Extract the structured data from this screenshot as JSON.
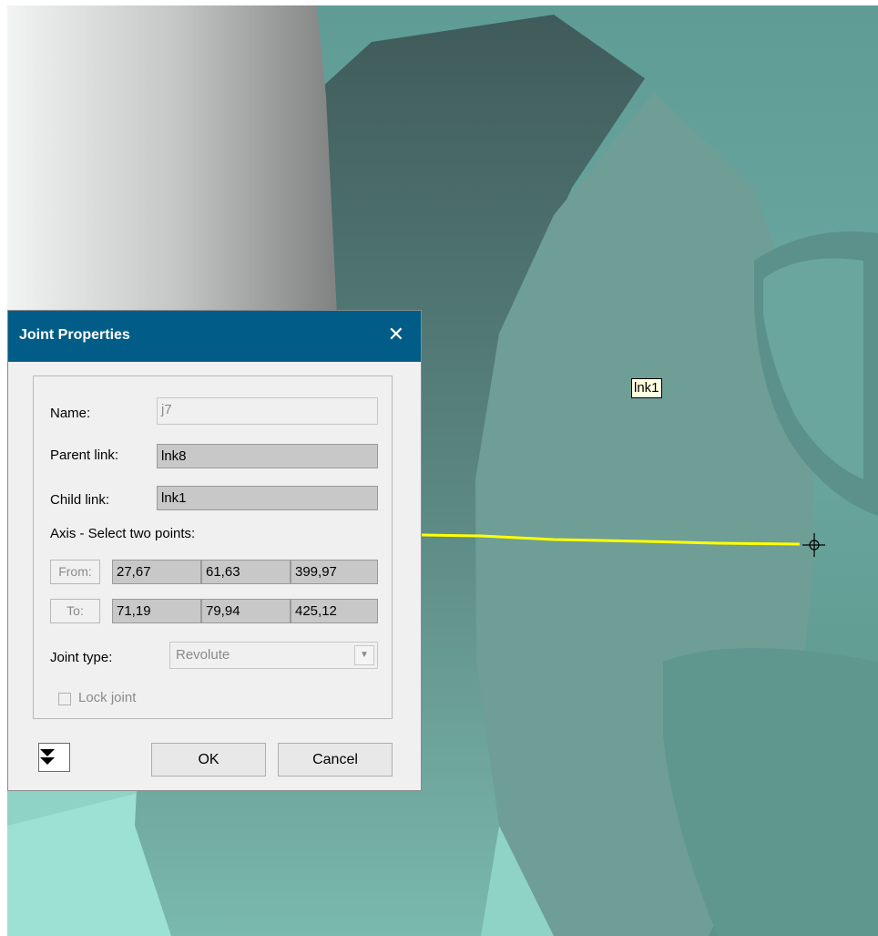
{
  "viewport": {
    "tooltip": "lnk1",
    "colors": {
      "teal_light": "#9adfd3",
      "teal_mid": "#6f9f96",
      "teal_dark": "#456a66",
      "axis_line": "#ffff00"
    }
  },
  "dialog": {
    "title": "Joint Properties",
    "close_label": "✕",
    "name_label": "Name:",
    "name_value": "j7",
    "parent_label": "Parent link:",
    "parent_value": "lnk8",
    "child_label": "Child link:",
    "child_value": "lnk1",
    "axis_label": "Axis - Select two points:",
    "from_button": "From:",
    "from_values": [
      "27,67",
      "61,63",
      "399,97"
    ],
    "to_button": "To:",
    "to_values": [
      "71,19",
      "79,94",
      "425,12"
    ],
    "joint_type_label": "Joint type:",
    "joint_type_value": "Revolute",
    "lock_label": "Lock joint",
    "expand_icon": "double-down-arrow",
    "ok_label": "OK",
    "cancel_label": "Cancel"
  }
}
